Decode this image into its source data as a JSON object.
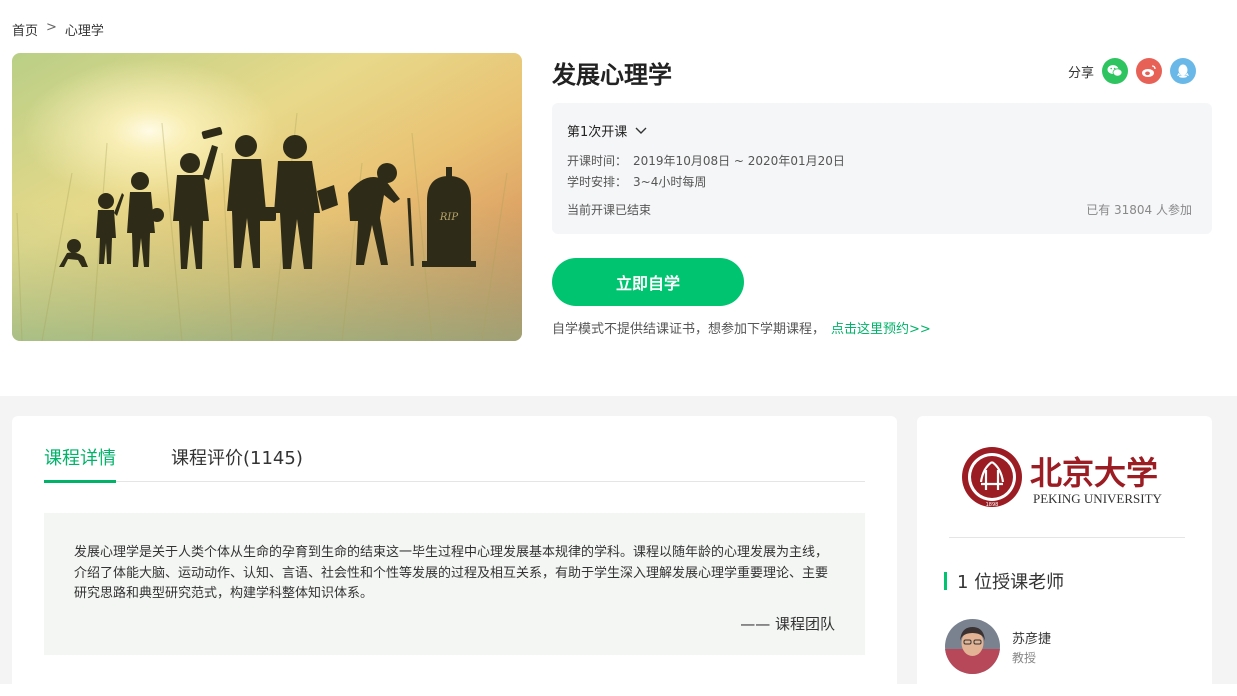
{
  "breadcrumb": {
    "home": "首页",
    "separator": ">",
    "current": "心理学"
  },
  "course": {
    "title": "发展心理学",
    "cover_tombstone_text": "RIP"
  },
  "share": {
    "label": "分享",
    "icons": [
      "wechat-icon",
      "weibo-icon",
      "qq-icon"
    ]
  },
  "session": {
    "selected": "第1次开课",
    "time_label": "开课时间：",
    "time_value": "2019年10月08日 ~ 2020年01月20日",
    "hours_label": "学时安排：",
    "hours_value": "3~4小时每周",
    "status": "当前开课已结束",
    "participants": "已有 31804 人参加"
  },
  "actions": {
    "start_button": "立即自学",
    "note": "自学模式不提供结课证书，想参加下学期课程，",
    "note_link": "点击这里预约>>"
  },
  "tabs": {
    "details": "课程详情",
    "reviews": "课程评价(1145)"
  },
  "description": {
    "text": "发展心理学是关于人类个体从生命的孕育到生命的结束这一毕生过程中心理发展基本规律的学科。课程以随年龄的心理发展为主线，介绍了体能大脑、运动动作、认知、言语、社会性和个性等发展的过程及相互关系，有助于学生深入理解发展心理学重要理论、主要研究思路和典型研究范式，构建学科整体知识体系。",
    "signature": "—— 课程团队"
  },
  "university": {
    "name_cn": "北京大学",
    "name_en": "PEKING UNIVERSITY",
    "seal_year": "1898"
  },
  "teachers": {
    "heading": "1 位授课老师",
    "list": [
      {
        "name": "苏彦捷",
        "title": "教授"
      }
    ]
  },
  "colors": {
    "accent": "#00c46f",
    "link": "#00b368",
    "wechat": "#2ec45f",
    "weibo": "#e86156",
    "qq": "#69b8e8",
    "pku_red": "#9b1c22"
  }
}
